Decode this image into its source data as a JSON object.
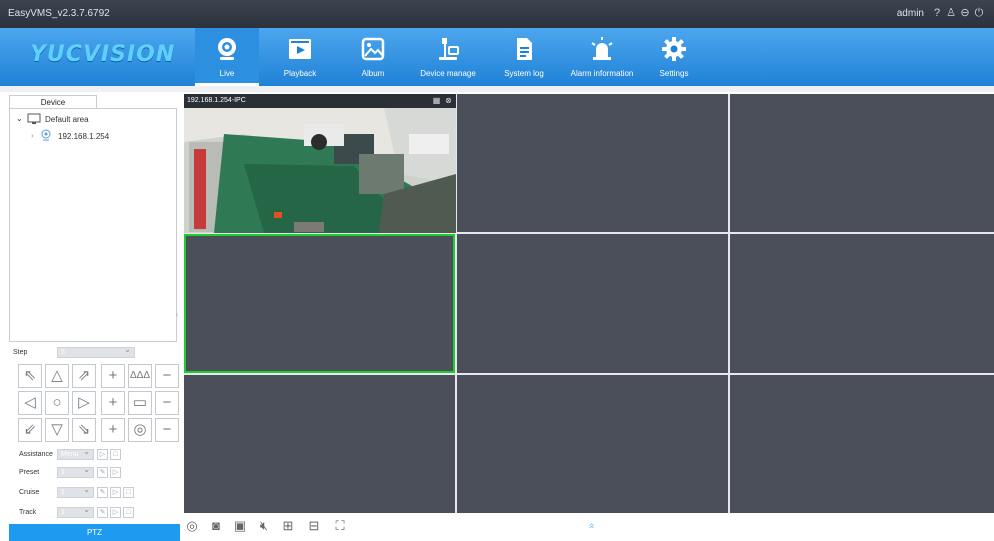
{
  "window": {
    "title": "EasyVMS_v2.3.7.6792",
    "user": "admin"
  },
  "titlebar_icons": [
    "help-icon",
    "user-icon",
    "minimize-icon",
    "power-icon"
  ],
  "brand": {
    "logo_text": "YUCVISION",
    "accent": "#1f82d6",
    "logo_color": "#5fd0ff"
  },
  "nav": [
    {
      "label": "Live",
      "icon": "webcam-icon",
      "active": true
    },
    {
      "label": "Playback",
      "icon": "playback-icon",
      "active": false
    },
    {
      "label": "Album",
      "icon": "album-icon",
      "active": false
    },
    {
      "label": "Device manage",
      "icon": "device-manage-icon",
      "active": false
    },
    {
      "label": "System log",
      "icon": "system-log-icon",
      "active": false
    },
    {
      "label": "Alarm information",
      "icon": "alarm-icon",
      "active": false
    },
    {
      "label": "Settings",
      "icon": "settings-icon",
      "active": false
    }
  ],
  "device_panel": {
    "tab": "Device",
    "tree": {
      "root": "Default area",
      "child": "192.168.1.254"
    }
  },
  "ptz": {
    "step_label": "Step",
    "step_value": "5",
    "assistance_label": "Assistance",
    "assistance_value": "Menu",
    "preset_label": "Preset",
    "preset_value": "1",
    "cruise_label": "Cruise",
    "cruise_value": "1",
    "track_label": "Track",
    "track_value": "1",
    "button_label": "PTZ"
  },
  "video": {
    "grid": "3x3",
    "channel1_title": "192.168.1.254-IPC",
    "selected_cell": 4,
    "selection_color": "#1fcc2b"
  },
  "bottom_tools": [
    "stop-all-icon",
    "snapshot-icon",
    "record-icon",
    "mute-icon",
    "grid-layout-icon",
    "multi-screen-icon",
    "fullscreen-icon"
  ],
  "collapse_glyph": "»"
}
